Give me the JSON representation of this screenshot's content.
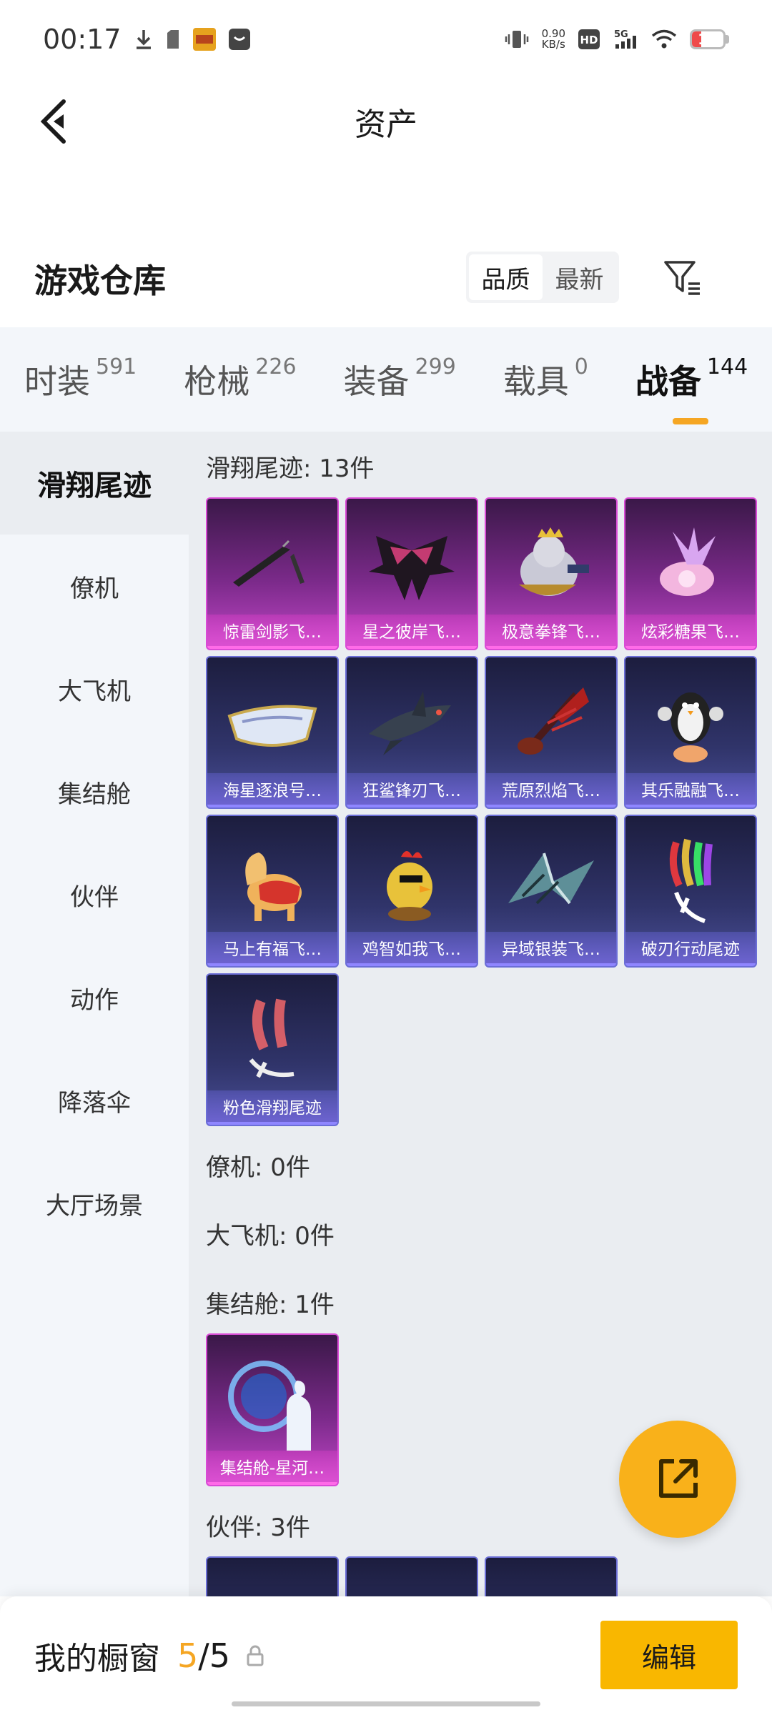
{
  "status_bar": {
    "time": "00:17",
    "speed_value": "0.90",
    "speed_unit": "KB/s",
    "hd_label": "HD",
    "network_label": "5G",
    "battery": "15"
  },
  "header": {
    "title": "资产"
  },
  "warehouse": {
    "title": "游戏仓库",
    "sort_options": [
      "品质",
      "最新"
    ],
    "sort_active": "品质"
  },
  "category_tabs": [
    {
      "label": "时装",
      "count": "591"
    },
    {
      "label": "枪械",
      "count": "226"
    },
    {
      "label": "装备",
      "count": "299"
    },
    {
      "label": "载具",
      "count": "0"
    },
    {
      "label": "战备",
      "count": "144"
    }
  ],
  "sidebar": {
    "items": [
      "滑翔尾迹",
      "僚机",
      "大飞机",
      "集结舱",
      "伙伴",
      "动作",
      "降落伞",
      "大厅场景"
    ]
  },
  "sections": [
    {
      "title": "滑翔尾迹: 13件",
      "items": [
        {
          "name": "惊雷剑影飞…",
          "rarity": "epic",
          "icon": "blade-icon"
        },
        {
          "name": "星之彼岸飞…",
          "rarity": "epic",
          "icon": "bat-wing-icon"
        },
        {
          "name": "极意拳锋飞…",
          "rarity": "epic",
          "icon": "king-fighter-icon"
        },
        {
          "name": "炫彩糖果飞…",
          "rarity": "epic",
          "icon": "candy-icon"
        },
        {
          "name": "海星逐浪号…",
          "rarity": "rare",
          "icon": "boat-icon"
        },
        {
          "name": "狂鲨锋刃飞…",
          "rarity": "rare",
          "icon": "shark-icon"
        },
        {
          "name": "荒原烈焰飞…",
          "rarity": "rare",
          "icon": "flame-guitar-icon"
        },
        {
          "name": "其乐融融飞…",
          "rarity": "rare",
          "icon": "penguin-icon"
        },
        {
          "name": "马上有福飞…",
          "rarity": "rare",
          "icon": "horse-icon"
        },
        {
          "name": "鸡智如我飞…",
          "rarity": "rare",
          "icon": "chicken-icon"
        },
        {
          "name": "异域银装飞…",
          "rarity": "rare",
          "icon": "silver-wing-icon"
        },
        {
          "name": "破刃行动尾迹",
          "rarity": "rare",
          "icon": "rainbow-smoke-icon"
        },
        {
          "name": "粉色滑翔尾迹",
          "rarity": "rare",
          "icon": "pink-smoke-icon"
        }
      ]
    },
    {
      "title": "僚机: 0件",
      "items": []
    },
    {
      "title": "大飞机: 0件",
      "items": []
    },
    {
      "title": "集结舱: 1件",
      "items": [
        {
          "name": "集结舱-星河…",
          "rarity": "epic",
          "icon": "portal-icon"
        }
      ]
    },
    {
      "title": "伙伴: 3件",
      "items": [
        {
          "name": "",
          "rarity": "rare",
          "icon": "partner-icon"
        },
        {
          "name": "",
          "rarity": "rare",
          "icon": "partner-icon"
        },
        {
          "name": "",
          "rarity": "rare",
          "icon": "partner-icon"
        }
      ]
    }
  ],
  "bottom_bar": {
    "label": "我的橱窗",
    "current": "5",
    "separator": "/",
    "max": "5",
    "edit_label": "编辑"
  },
  "colors": {
    "accent": "#f5a623",
    "edit_button": "#f9b700",
    "epic": "#c046c6",
    "rare": "#4a4f98"
  }
}
